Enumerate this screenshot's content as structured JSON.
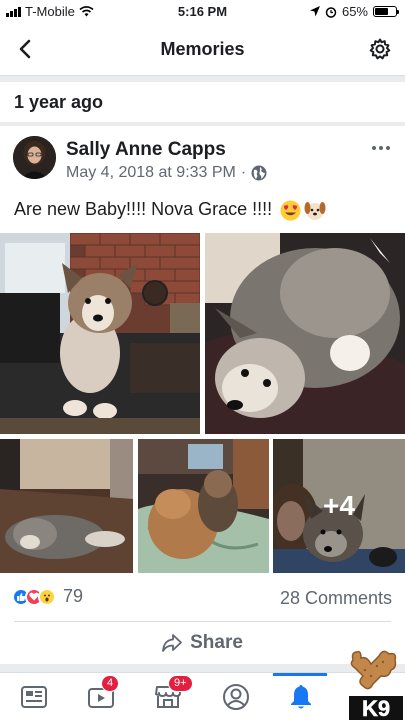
{
  "status_bar": {
    "carrier": "T-Mobile",
    "time": "5:16 PM",
    "battery": "65%",
    "battery_level": 0.65
  },
  "nav": {
    "title": "Memories",
    "back_icon": "chevron-left-icon",
    "settings_icon": "gear-icon"
  },
  "section": {
    "title": "1 year ago"
  },
  "post": {
    "author": "Sally Anne Capps",
    "date": "May 4, 2018 at 9:33 PM",
    "separator": "·",
    "privacy_icon": "globe-icon",
    "text": "Are new Baby!!!! Nova Grace !!!!",
    "emojis": [
      "heart-eyes-emoji",
      "dog-face-emoji"
    ],
    "photos": [
      {
        "name": "puppy-sitting-photo"
      },
      {
        "name": "puppy-closeup-photo"
      },
      {
        "name": "puppy-lying-photo"
      },
      {
        "name": "dogs-on-bed-photo"
      },
      {
        "name": "puppy-with-person-photo",
        "more_label": "+4"
      }
    ],
    "reactions": {
      "count": "79",
      "types": [
        "like",
        "love",
        "wow"
      ]
    },
    "comments": "28 Comments",
    "share_label": "Share"
  },
  "tabbar": {
    "tabs": [
      {
        "name": "news-feed",
        "badge": ""
      },
      {
        "name": "watch",
        "badge": "4"
      },
      {
        "name": "marketplace",
        "badge": "9+"
      },
      {
        "name": "profile",
        "badge": ""
      },
      {
        "name": "notifications",
        "badge": "",
        "active": true
      }
    ]
  },
  "watermark": {
    "text": "K9"
  },
  "colors": {
    "accent": "#1877f2",
    "badge": "#e41e3f",
    "text": "#1c1e21",
    "secondary": "#606770"
  }
}
